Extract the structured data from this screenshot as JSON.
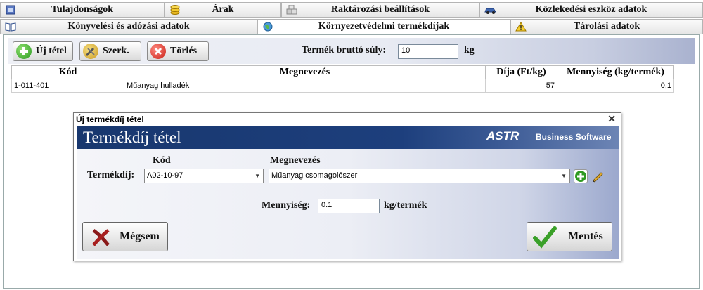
{
  "tabs_row1": [
    {
      "label": "Tulajdonságok",
      "icon": "properties-icon"
    },
    {
      "label": "Árak",
      "icon": "coins-icon"
    },
    {
      "label": "Raktározási beállítások",
      "icon": "boxes-icon"
    },
    {
      "label": "Közlekedési eszköz adatok",
      "icon": "car-icon"
    }
  ],
  "tabs_row2": [
    {
      "label": "Könyvelési és adózási adatok",
      "icon": "book-icon"
    },
    {
      "label": "Környezetvédelmi termékdíjak",
      "icon": "globe-icon"
    },
    {
      "label": "Tárolási adatok",
      "icon": "warning-icon"
    }
  ],
  "toolbar": {
    "new_label": "Új tétel",
    "edit_label": "Szerk.",
    "delete_label": "Törlés",
    "gross_weight_label": "Termék bruttó súly:",
    "gross_weight_value": "10",
    "gross_weight_unit": "kg"
  },
  "grid": {
    "headers": [
      "Kód",
      "Megnevezés",
      "Díja (Ft/kg)",
      "Mennyiség (kg/termék)"
    ],
    "rows": [
      [
        "1-011-401",
        "Műanyag hulladék",
        "57",
        "0,1"
      ]
    ]
  },
  "dialog": {
    "window_title": "Új termékdíj tétel",
    "close": "✕",
    "banner_title": "Termékdíj tétel",
    "banner_brand": "ASTR",
    "banner_sub": "Business Software",
    "code_header": "Kód",
    "name_header": "Megnevezés",
    "product_fee_label": "Termékdíj:",
    "code_value": "A02-10-97",
    "name_value": "Műanyag csomagolószer",
    "quantity_label": "Mennyiség:",
    "quantity_value": "0.1",
    "quantity_unit": "kg/termék",
    "cancel_label": "Mégsem",
    "save_label": "Mentés"
  }
}
